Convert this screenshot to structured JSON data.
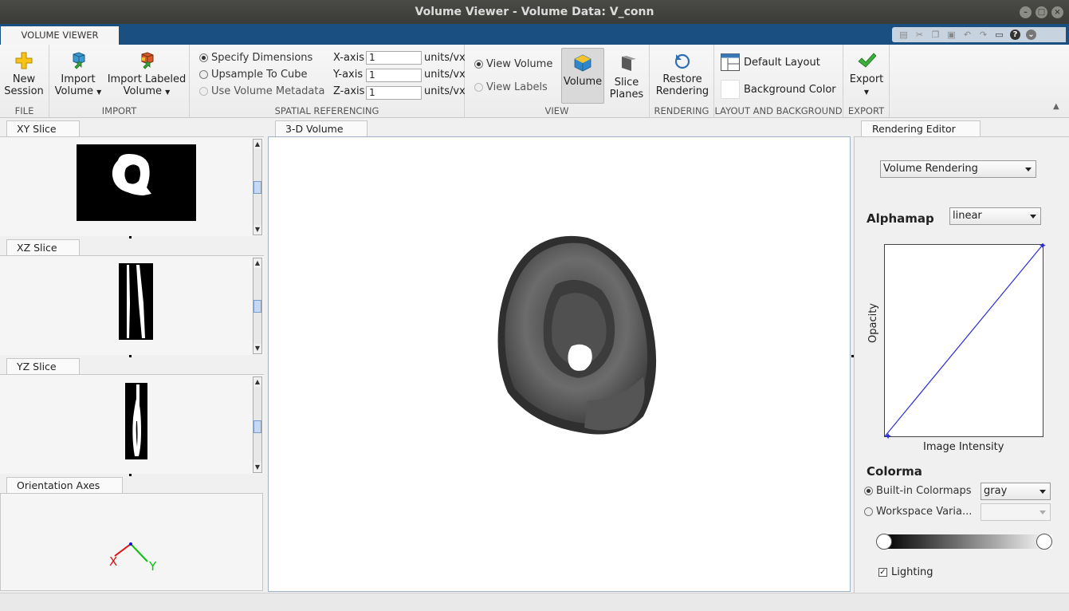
{
  "window": {
    "title": "Volume Viewer - Volume Data: V_conn"
  },
  "tabs": {
    "active": "VOLUME VIEWER"
  },
  "toolstrip": {
    "file": {
      "label": "FILE",
      "new_session": [
        "New",
        "Session"
      ]
    },
    "import": {
      "label": "IMPORT",
      "import_volume": [
        "Import",
        "Volume"
      ],
      "import_labeled": [
        "Import Labeled",
        "Volume"
      ]
    },
    "spatial": {
      "label": "SPATIAL REFERENCING",
      "options": [
        "Specify Dimensions",
        "Upsample To Cube",
        "Use Volume Metadata"
      ],
      "selected": "Specify Dimensions",
      "axes": [
        {
          "label": "X-axis",
          "value": "1",
          "units": "units/vx"
        },
        {
          "label": "Y-axis",
          "value": "1",
          "units": "units/vx"
        },
        {
          "label": "Z-axis",
          "value": "1",
          "units": "units/vx"
        }
      ]
    },
    "view": {
      "label": "VIEW",
      "options": [
        "View Volume",
        "View Labels"
      ],
      "volume": "Volume",
      "slice_planes": [
        "Slice",
        "Planes"
      ]
    },
    "rendering": {
      "label": "RENDERING",
      "restore": [
        "Restore",
        "Rendering"
      ]
    },
    "layout": {
      "label": "LAYOUT AND BACKGROUND",
      "default_layout": "Default Layout",
      "background_color": "Background Color"
    },
    "export": {
      "label": "EXPORT",
      "export": "Export"
    }
  },
  "left_panels": {
    "xy": "XY Slice",
    "xz": "XZ Slice",
    "yz": "YZ Slice",
    "orientation": "Orientation Axes",
    "axis_x": "X",
    "axis_y": "Y"
  },
  "center": {
    "tab": "3-D Volume"
  },
  "rendering_editor": {
    "tab": "Rendering Editor",
    "mode": "Volume Rendering",
    "alphamap_title": "Alphamap",
    "alphamap_mode": "linear",
    "ylabel": "Opacity",
    "xlabel": "Image Intensity",
    "colormap_title": "Colorma",
    "builtin_label": "Built-in Colormaps",
    "builtin_value": "gray",
    "workspace_label": "Workspace Varia...",
    "lighting_label": "Lighting",
    "lighting_checked": true
  },
  "colors": {
    "tab_strip": "#1a4f82",
    "curve": "#2d2dd8",
    "axis_x": "#e01010",
    "axis_y": "#10c010"
  }
}
